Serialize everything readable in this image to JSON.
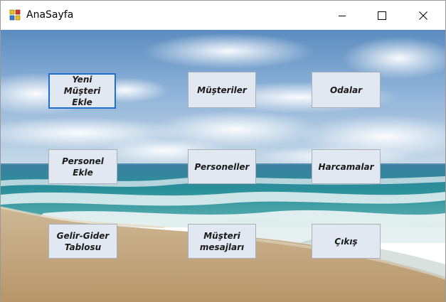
{
  "window": {
    "title": "AnaSayfa"
  },
  "controls": {
    "minimize_icon": "minimize-icon",
    "maximize_icon": "maximize-icon",
    "close_icon": "close-icon"
  },
  "background": {
    "sky_top": "#5f8fc3",
    "sky_mid": "#a9c6e2",
    "sea": "#2d8a96",
    "foam": "#dde9ee",
    "sand": "#c7aa84"
  },
  "buttons": {
    "yeni_musteri": "Yeni\nMüşteri Ekle",
    "musteriler": "Müşteriler",
    "odalar": "Odalar",
    "personel_ekle": "Personel\nEkle",
    "personeller": "Personeller",
    "harcamalar": "Harcamalar",
    "gelir_gider": "Gelir-Gider\nTablosu",
    "musteri_mesajlari": "Müşteri\nmesajları",
    "cikis": "Çıkış"
  },
  "colors": {
    "button_face": "#e1e8f2",
    "focus_border": "#1e6fd0"
  }
}
